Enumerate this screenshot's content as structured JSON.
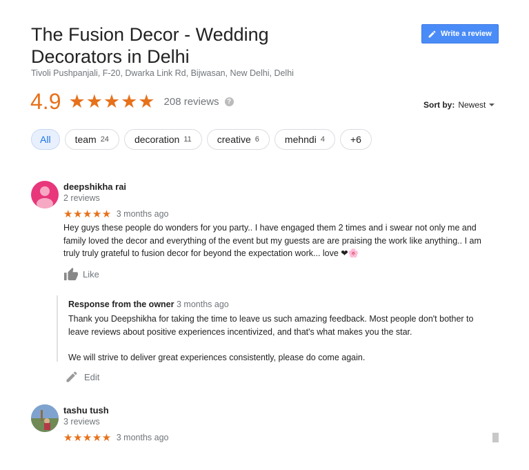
{
  "header": {
    "title": "The Fusion Decor - Wedding Decorators in Delhi",
    "address": "Tivoli Pushpanjali, F-20, Dwarka Link Rd, Bijwasan, New Delhi, Delhi",
    "write_review_label": "Write a review"
  },
  "summary": {
    "rating": "4.9",
    "stars": "★★★★★",
    "review_count": "208 reviews",
    "help_icon": "?"
  },
  "sort": {
    "label": "Sort by:",
    "value": "Newest"
  },
  "chips": [
    {
      "label": "All",
      "count": ""
    },
    {
      "label": "team",
      "count": "24"
    },
    {
      "label": "decoration",
      "count": "11"
    },
    {
      "label": "creative",
      "count": "6"
    },
    {
      "label": "mehndi",
      "count": "4"
    },
    {
      "label": "+6",
      "count": ""
    }
  ],
  "reviews": [
    {
      "name": "deepshikha rai",
      "sub": "2 reviews",
      "stars": "★★★★★",
      "ago": "3 months ago",
      "text": "Hey guys these people do wonders for you party.. I have engaged them 2 times and i swear not only me and family loved the decor and everything of the event but my guests are are praising the work like anything.. I am truly truly grateful to fusion decor for beyond the expectation work... love ❤🌸",
      "like_label": "Like",
      "response": {
        "heading": "Response from the owner",
        "ago": "3 months ago",
        "para1": "Thank you Deepshikha for taking the time to leave us such amazing feedback. Most people don't bother to leave reviews about positive experiences incentivized, and that's what makes you the star.",
        "para2": "We will strive to deliver great experiences consistently, please do come again."
      },
      "edit_label": "Edit"
    },
    {
      "name": "tashu tush",
      "sub": "3 reviews",
      "stars": "★★★★★",
      "ago": "3 months ago"
    }
  ],
  "colors": {
    "accent_orange": "#e7711b",
    "button_blue": "#4a8cf7",
    "active_chip_bg": "#e8f0fe",
    "avatar_pink": "#e8377a"
  },
  "icons": [
    "pencil-icon",
    "help-icon",
    "caret-down-icon",
    "thumbs-up-icon",
    "edit-pencil-icon",
    "person-avatar-icon"
  ]
}
